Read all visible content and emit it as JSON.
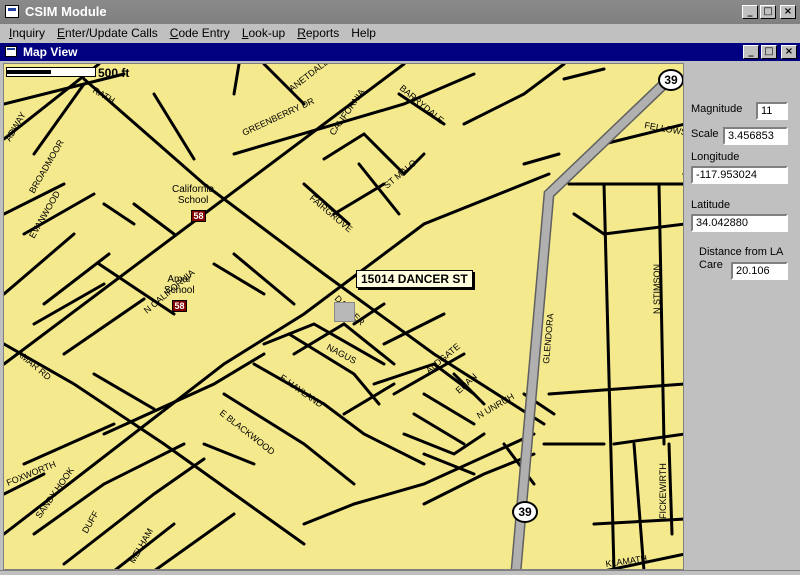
{
  "app": {
    "title": "CSIM Module",
    "window_buttons": {
      "minimize": "_",
      "maximize": "□",
      "close": "×"
    }
  },
  "menu": [
    {
      "label": "Inquiry",
      "underline": "I",
      "rest": "nquiry"
    },
    {
      "label": "Enter/Update Calls",
      "underline": "E",
      "rest": "nter/Update Calls"
    },
    {
      "label": "Code Entry",
      "underline": "C",
      "rest": "ode Entry"
    },
    {
      "label": "Look-up",
      "underline": "L",
      "rest": "ook-up"
    },
    {
      "label": "Reports",
      "underline": "R",
      "rest": "eports"
    },
    {
      "label": "Help",
      "underline": "",
      "rest": "Help"
    }
  ],
  "map_window": {
    "title": "Map View"
  },
  "map": {
    "scale_label": "500 ft",
    "callout": "15014 DANCER ST",
    "highway_number": "39",
    "route_number": "58",
    "places": [
      {
        "line1": "California",
        "line2": "School"
      },
      {
        "line1": "Amar",
        "line2": "School"
      }
    ],
    "streets": [
      "ANETDALE",
      "RATH",
      "GREENBERRY DR",
      "CALIFORNIA",
      "BARRYDALE",
      "FELLOWS",
      "ADWAY",
      "BROADMOOR",
      "ST MALO",
      "FAIRGROVE",
      "EVANWOOD",
      "GLENDORA",
      "N STIMSON",
      "N CALIFORNIA",
      "DANCER",
      "NAGUS",
      "ALDGATE",
      "AMAR RD",
      "E HAYLAND",
      "EDAN",
      "N UNRUH",
      "E BLACKWOOD",
      "FOXWORTH",
      "SANDY HOOK",
      "DUFF",
      "MELHAM",
      "FICKEWIRTH",
      "KLAMATH"
    ],
    "colors": {
      "background": "#f4e98c",
      "road": "#000000",
      "highway": "#a0a0a0"
    }
  },
  "side_panel": {
    "magnitude": {
      "label": "Magnitude",
      "value": "11"
    },
    "scale": {
      "label": "Scale",
      "value": "3.456853"
    },
    "longitude": {
      "label": "Longitude",
      "value": "-117.953024"
    },
    "latitude": {
      "label": "Latitude",
      "value": "34.042880"
    },
    "distance": {
      "label_line1": "Distance from LA",
      "label_line2": "Care",
      "value": "20.106"
    }
  }
}
